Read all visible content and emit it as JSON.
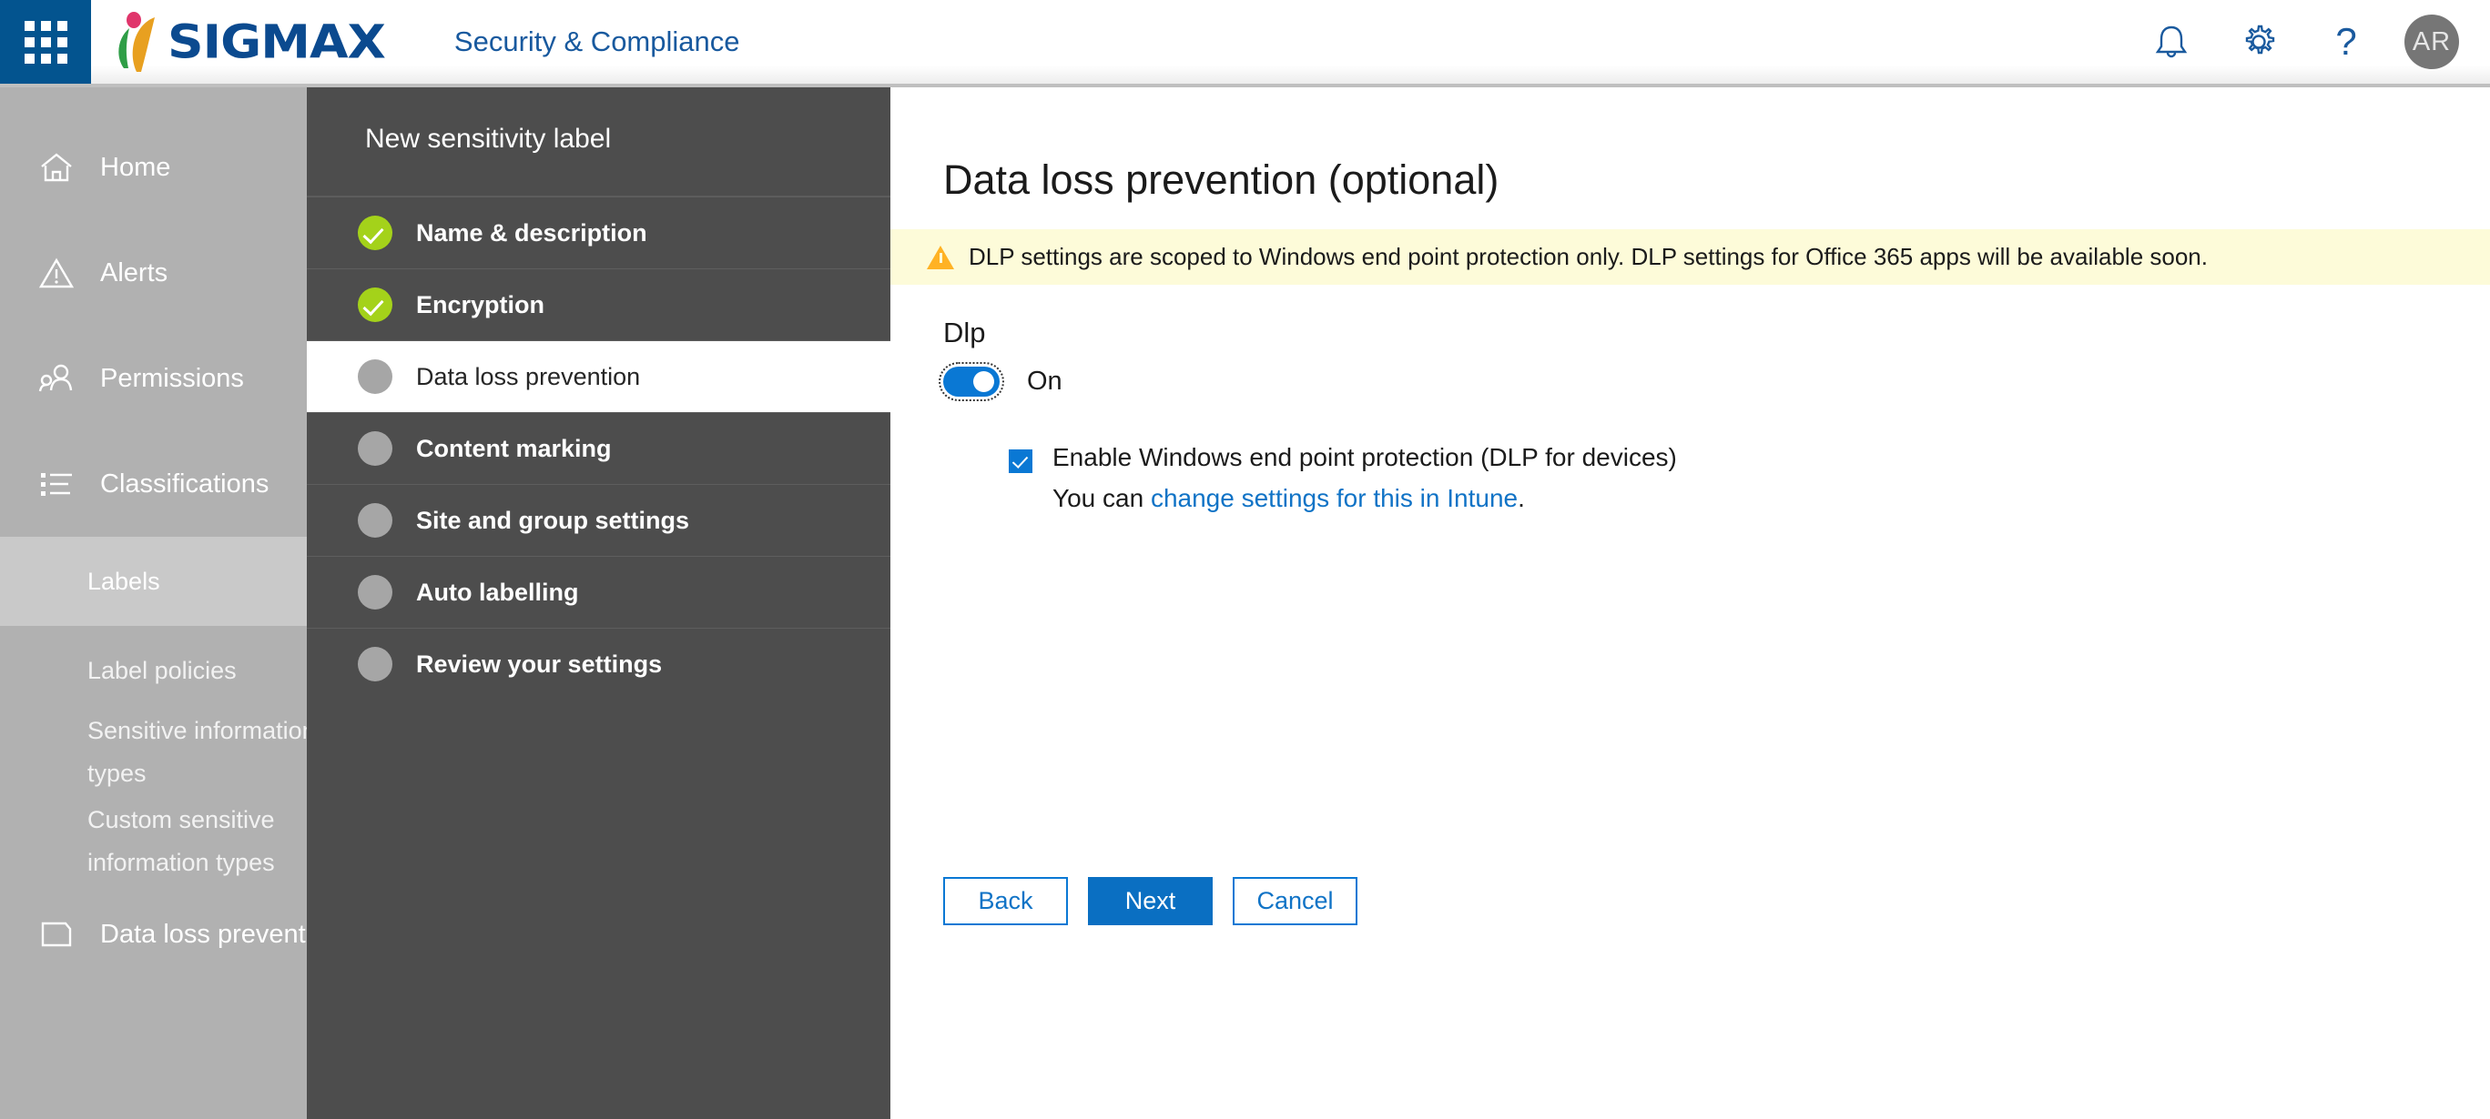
{
  "topbar": {
    "waffle_label": "app-launcher",
    "brand_text": "SIGMAX",
    "app_title": "Security & Compliance",
    "notifications_icon": "bell-icon",
    "settings_icon": "gear-icon",
    "help_icon": "question-mark-icon",
    "help_glyph": "?",
    "avatar_initials": "AR",
    "brand_color": "#0b4a8f",
    "accent_color": "#03548f"
  },
  "leftnav": {
    "items": [
      {
        "label": "Home",
        "icon": "home-icon"
      },
      {
        "label": "Alerts",
        "icon": "warning-triangle-icon"
      },
      {
        "label": "Permissions",
        "icon": "people-icon"
      },
      {
        "label": "Classifications",
        "icon": "list-icon"
      }
    ],
    "subitems": [
      {
        "label": "Labels",
        "active": true
      },
      {
        "label": "Label policies",
        "active": false
      },
      {
        "label": "Sensitive information",
        "active": false
      },
      {
        "label": "types",
        "active": false
      },
      {
        "label": "Custom sensitive",
        "active": false
      },
      {
        "label": "information types",
        "active": false
      }
    ],
    "bottom_item": {
      "label": "Data loss prevention",
      "icon": "shield-icon"
    }
  },
  "wizard": {
    "title": "New sensitivity label",
    "steps": [
      {
        "label": "Name & description",
        "state": "done"
      },
      {
        "label": "Encryption",
        "state": "done"
      },
      {
        "label": "Data loss prevention",
        "state": "active"
      },
      {
        "label": "Content marking",
        "state": "pending"
      },
      {
        "label": "Site and group settings",
        "state": "pending"
      },
      {
        "label": "Auto labelling",
        "state": "pending"
      },
      {
        "label": "Review your settings",
        "state": "pending"
      }
    ]
  },
  "content": {
    "title": "Data loss prevention (optional)",
    "close_icon": "close-icon",
    "warning": {
      "icon": "warning-triangle-icon",
      "text": "DLP settings are scoped to Windows end point protection only. DLP settings for Office 365 apps will be available soon."
    },
    "dlp_section_heading": "Dlp",
    "toggle": {
      "state_label": "On",
      "on": true,
      "color": "#0a78d4"
    },
    "checkbox": {
      "label": "Enable Windows end point protection (DLP for devices)",
      "checked": true
    },
    "sub_text_prefix": "You can ",
    "sub_link_text": "change settings for this in Intune",
    "sub_text_suffix": ".",
    "buttons": {
      "back": "Back",
      "next": "Next",
      "cancel": "Cancel"
    }
  }
}
